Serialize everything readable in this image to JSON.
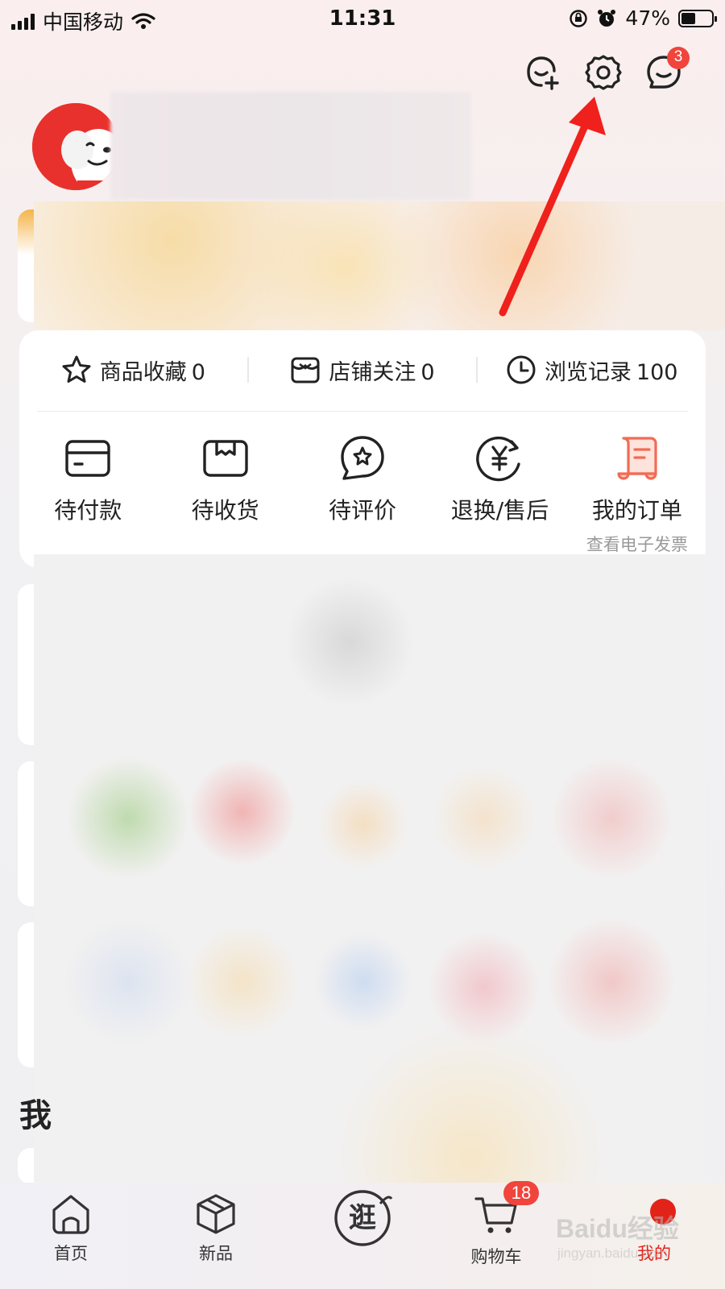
{
  "status_bar": {
    "carrier": "中国移动",
    "time": "11:31",
    "battery_percent": "47%",
    "battery_level": 0.47
  },
  "top_actions": {
    "add_friend_icon": "add-friend-icon",
    "settings_icon": "gear-icon",
    "messages_icon": "message-icon",
    "messages_badge": "3"
  },
  "favorites_row": [
    {
      "label": "商品收藏",
      "count": "0",
      "icon": "star-icon"
    },
    {
      "label": "店铺关注",
      "count": "0",
      "icon": "store-icon"
    },
    {
      "label": "浏览记录",
      "count": "100",
      "icon": "clock-icon"
    }
  ],
  "orders": [
    {
      "label": "待付款",
      "icon": "card-icon"
    },
    {
      "label": "待收货",
      "icon": "package-icon"
    },
    {
      "label": "待评价",
      "icon": "review-icon"
    },
    {
      "label": "退换/售后",
      "icon": "yuan-refund-icon"
    },
    {
      "label": "我的订单",
      "sublabel": "查看电子发票",
      "icon": "order-list-icon"
    }
  ],
  "partial_heading": "我",
  "bottom_nav": [
    {
      "label": "首页",
      "icon": "home-icon"
    },
    {
      "label": "新品",
      "icon": "cube-icon"
    },
    {
      "label": "逛",
      "icon": "stroll-icon"
    },
    {
      "label": "购物车",
      "icon": "cart-icon",
      "badge": "18"
    },
    {
      "label": "我的",
      "icon": "profile-icon",
      "active": true
    }
  ],
  "watermark": {
    "brand": "Baidu经验",
    "url": "jingyan.baidu.com"
  },
  "colors": {
    "accent_red": "#e2231a",
    "badge_red": "#f0443c",
    "annotation_arrow": "#f0201c",
    "order_highlight": "#f26b55"
  }
}
